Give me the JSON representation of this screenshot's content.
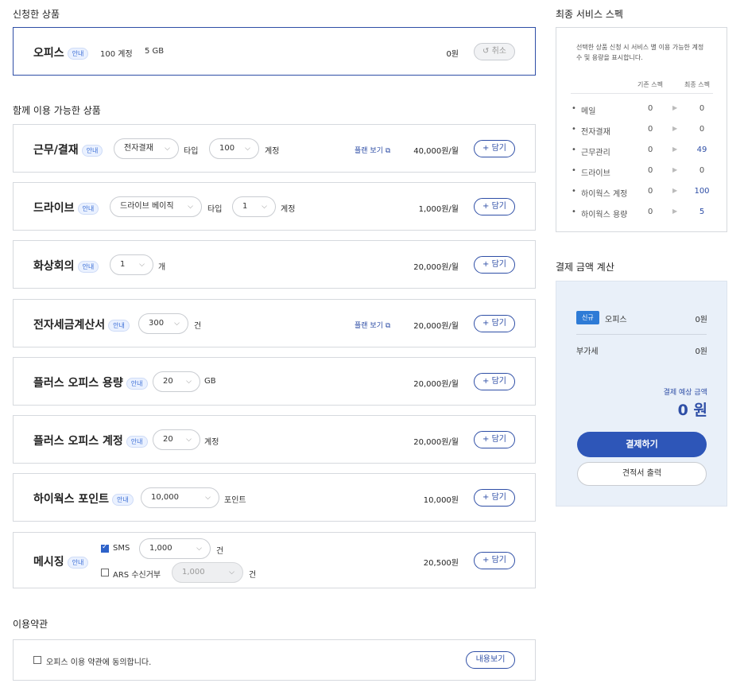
{
  "applied": {
    "title": "신청한 상품",
    "product": {
      "name": "오피스",
      "badge": "안내",
      "accounts": "100 계정",
      "storage": "5 GB",
      "price": "0원",
      "cancel": "↺ 취소"
    }
  },
  "addons": {
    "title": "함께 이용 가능한 상품",
    "items": [
      {
        "name": "근무/결재",
        "badge": "안내",
        "select1": "전자결재",
        "unit1": "타입",
        "select2": "100",
        "unit2": "계정",
        "plan_link": "플랜 보기 ⧉",
        "price": "40,000원/월",
        "add": "+ 담기"
      },
      {
        "name": "드라이브",
        "badge": "안내",
        "select1": "드라이브 베이직",
        "unit1": "타입",
        "select2": "1",
        "unit2": "계정",
        "price": "1,000원/월",
        "add": "+ 담기"
      },
      {
        "name": "화상회의",
        "badge": "안내",
        "select1": "1",
        "unit1": "개",
        "price": "20,000원/월",
        "add": "+ 담기"
      },
      {
        "name": "전자세금계산서",
        "badge": "안내",
        "select1": "300",
        "unit1": "건",
        "plan_link": "플랜 보기 ⧉",
        "price": "20,000원/월",
        "add": "+ 담기"
      },
      {
        "name": "플러스 오피스 용량",
        "badge": "안내",
        "select1": "20",
        "unit1": "GB",
        "price": "20,000원/월",
        "add": "+ 담기"
      },
      {
        "name": "플러스 오피스 계정",
        "badge": "안내",
        "select1": "20",
        "unit1": "계정",
        "price": "20,000원/월",
        "add": "+ 담기"
      },
      {
        "name": "하이웍스 포인트",
        "badge": "안내",
        "select1": "10,000",
        "unit1": "포인트",
        "price": "10,000원",
        "add": "+ 담기"
      }
    ],
    "messaging": {
      "name": "메시징",
      "badge": "안내",
      "sms_label": "SMS",
      "sms_checked": true,
      "sms_value": "1,000",
      "sms_unit": "건",
      "ars_label": "ARS 수신거부",
      "ars_checked": false,
      "ars_value": "1,000",
      "ars_unit": "건",
      "price": "20,500원",
      "add": "+ 담기"
    }
  },
  "terms": {
    "title": "이용약관",
    "label": "오피스 이용 약관에 동의합니다.",
    "view": "내용보기"
  },
  "spec": {
    "title": "최종 서비스 스펙",
    "desc": "선택한 상품 신청 시 서비스 별 이용 가능한 계정 수 및 용량을 표시합니다.",
    "col_base": "기존 스펙",
    "col_final": "최종 스펙",
    "rows": [
      {
        "label": "메일",
        "base": "0",
        "final": "0",
        "highlight": false
      },
      {
        "label": "전자결재",
        "base": "0",
        "final": "0",
        "highlight": false
      },
      {
        "label": "근무관리",
        "base": "0",
        "final": "49",
        "highlight": true
      },
      {
        "label": "드라이브",
        "base": "0",
        "final": "0",
        "highlight": false
      },
      {
        "label": "하이웍스 계정",
        "base": "0",
        "final": "100",
        "highlight": true
      },
      {
        "label": "하이웍스 용량",
        "base": "0",
        "final": "5",
        "highlight": true
      }
    ]
  },
  "payment": {
    "title": "결제 금액 계산",
    "new_badge": "신규",
    "item": "오피스",
    "item_price": "0원",
    "vat_label": "부가세",
    "vat": "0원",
    "expected_label": "결제 예상 금액",
    "expected": "0 원",
    "pay_button": "결제하기",
    "quote_button": "견적서 출력"
  }
}
